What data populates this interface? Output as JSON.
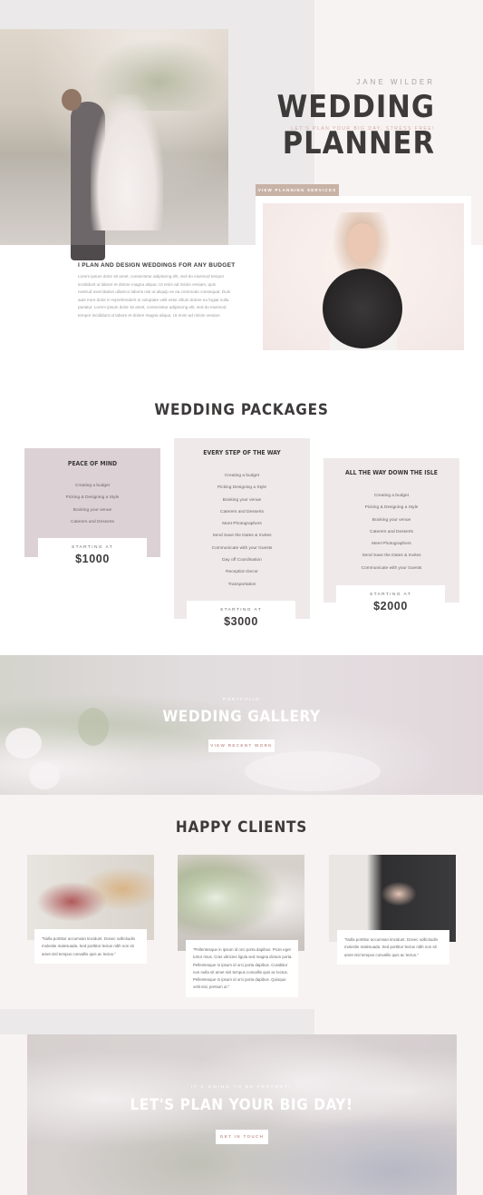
{
  "hero": {
    "brand": "JANE WILDER",
    "title": "WEDDING PLANNER",
    "tagline": "LET'S PLAN YOUR BIG DAY, STRESS FREE!",
    "planning_button": "VIEW PLANNING SERVICES",
    "intro_heading": "I PLAN AND DESIGN WEDDINGS FOR ANY BUDGET",
    "intro_text": "Lorem ipsum dolor sit amet, consectetur adipiscing elit, sed do eiusmod tempor incididunt ut labore et dolore magna aliqua. Ut enim ad minim veniam, quis nostrud exercitation ullamco laboris nisi ut aliquip ex ea commodo consequat. Duis aute irure dolor in reprehenderit in voluptate velit esse cillum dolore eu fugiat nulla pariatur. Lorem ipsum dolor sit amet, consectetur adipiscing elit, sed do eiusmod tempor incididunt ut labore et dolore magna aliqua. Ut enim ad minim veniam"
  },
  "packages": {
    "title": "WEDDING PACKAGES",
    "cards": [
      {
        "name": "PEACE OF MIND",
        "items": [
          "Creating a budget",
          "Picking & Designing a Style",
          "Booking your venue",
          "Caterers and Desserts"
        ],
        "starting_label": "STARTING AT",
        "price": "$1000"
      },
      {
        "name": "EVERY STEP OF THE WAY",
        "items": [
          "Creating a budget",
          "Picking Designing a Style",
          "Booking your venue",
          "Caterers and Desserts",
          "Meet Photographers",
          "Send Save the Dates & Invites",
          "Communicate with your Guests",
          "Day off Coordination",
          "Reception Decor",
          "Transportation"
        ],
        "starting_label": "STARTING AT",
        "price": "$3000"
      },
      {
        "name": "ALL THE WAY DOWN THE ISLE",
        "items": [
          "Creating a budget",
          "Picking & Designing a Style",
          "Booking your venue",
          "Caterers and Desserts",
          "Meet Photographers",
          "Send Save the Dates & Invites",
          "Communicate with your Guests"
        ],
        "starting_label": "STARTING AT",
        "price": "$2000"
      }
    ]
  },
  "gallery": {
    "kicker": "PORTFOLIO",
    "title": "WEDDING GALLERY",
    "button": "VIEW RECENT WORK"
  },
  "clients": {
    "title": "HAPPY CLIENTS",
    "quotes": [
      "\"Nulla porttitor accumsan tincidunt. Donec sollicitudin molestie malesuada. Sed porttitor lectus nibh non sit amet nisl tempus convallis quis ac lectus.\"",
      "\"Pellentesque in ipsum id orci porta dapibus. Proin eget tortor risus. Cras ultricies ligula sed magna dictum porta. Pellentesque in ipsum id orci porta dapibus. Curabitur non nulla sit amet nisl tempus convallis quis ac lectus. Pellentesque in ipsum id orci porta dapibus. Quisque velit nisi, pretium ut.\"",
      "\"Nulla porttitor accumsan tincidunt. Donec sollicitudin molestie malesuada. Sed porttitor lectus nibh non sit amet nisl tempus convallis quis ac lectus.\""
    ]
  },
  "cta": {
    "kicker": "IT'S GOING TO BE PERFECT!",
    "title": "LET'S PLAN YOUR BIG DAY!",
    "button": "GET IN TOUCH"
  },
  "colors": {
    "accent": "#c8b2a6",
    "blush_text": "#d4a8a4",
    "card_dark": "#dcd2d5",
    "card_light": "#efe9e9",
    "heading": "#3d3a3a"
  }
}
